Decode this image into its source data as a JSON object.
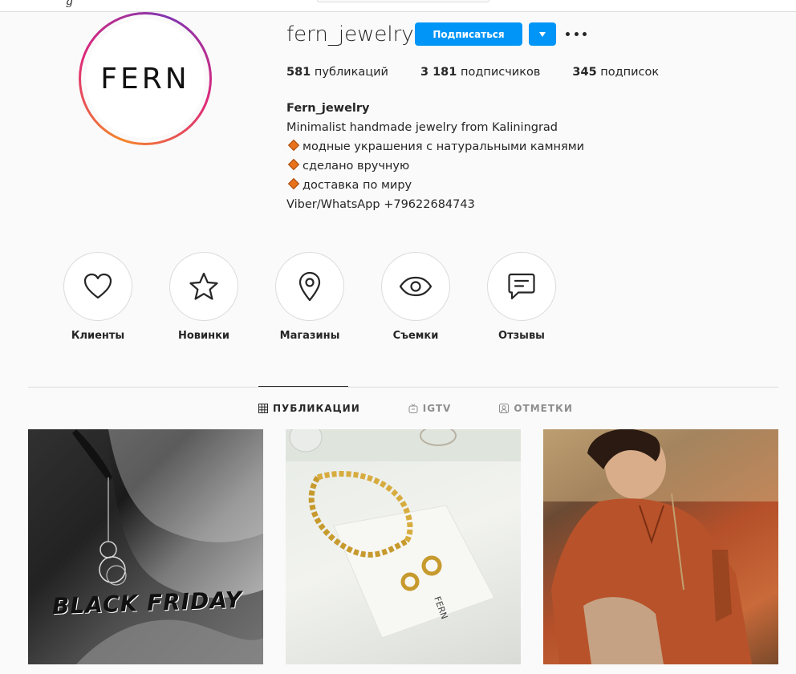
{
  "profile": {
    "username": "fern_jewelry",
    "avatar_text": "FERN",
    "follow_label": "Подписаться",
    "stats": {
      "posts_count": "581",
      "posts_label": "публикаций",
      "followers_count": "3 181",
      "followers_label": "подписчиков",
      "following_count": "345",
      "following_label": "подписок"
    },
    "bio": {
      "name": "Fern_jewelry",
      "line1": "Minimalist handmade jewelry from Kaliningrad",
      "line2": "модные украшения с натуральными камнями",
      "line3": "сделано вручную",
      "line4": "доставка по миру",
      "line5": "Viber/WhatsApp +79622684743"
    }
  },
  "highlights": [
    {
      "label": "Клиенты",
      "icon": "heart-icon"
    },
    {
      "label": "Новинки",
      "icon": "star-icon"
    },
    {
      "label": "Магазины",
      "icon": "map-pin-icon"
    },
    {
      "label": "Съемки",
      "icon": "eye-icon"
    },
    {
      "label": "Отзывы",
      "icon": "chat-icon"
    }
  ],
  "tabs": [
    {
      "label": "ПУБЛИКАЦИИ",
      "icon": "grid-icon",
      "active": true
    },
    {
      "label": "IGTV",
      "icon": "igtv-icon",
      "active": false
    },
    {
      "label": "ОТМЕТКИ",
      "icon": "tagged-icon",
      "active": false
    }
  ],
  "posts": [
    {
      "overlay_text": "BLACK FRIDAY"
    },
    {
      "overlay_text": ""
    },
    {
      "overlay_text": ""
    }
  ],
  "colors": {
    "accent": "#0095f6",
    "text": "#262626",
    "muted": "#8e8e8e",
    "border": "#dbdbdb",
    "bullet": "#e8711c"
  }
}
